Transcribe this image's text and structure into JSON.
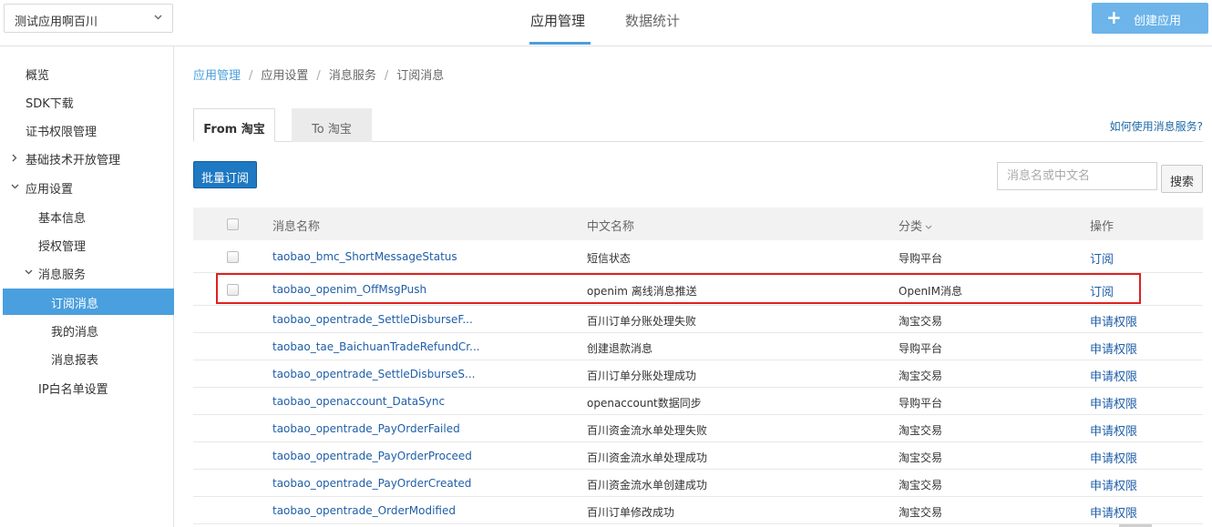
{
  "header": {
    "app_selector": "测试应用啊百川",
    "nav_tabs": [
      "应用管理",
      "数据统计"
    ],
    "create_button": "创建应用",
    "accent_color": "#4a9fde"
  },
  "sidebar": {
    "items": [
      "概览",
      "SDK下载",
      "证书权限管理",
      "基础技术开放管理",
      "应用设置",
      "基本信息",
      "授权管理",
      "消息服务",
      "订阅消息",
      "我的消息",
      "消息报表",
      "IP白名单设置"
    ],
    "active": "订阅消息"
  },
  "breadcrumb": [
    "应用管理",
    "应用设置",
    "消息服务",
    "订阅消息"
  ],
  "tabs": {
    "from": "From 淘宝",
    "to": "To 淘宝"
  },
  "help_link": "如何使用消息服务?",
  "toolbar": {
    "batch_button": "批量订阅",
    "search_placeholder": "消息名或中文名",
    "search_button": "搜索"
  },
  "table": {
    "headers": {
      "name": "消息名称",
      "cn_name": "中文名称",
      "category": "分类",
      "action": "操作"
    },
    "rows": [
      {
        "name": "taobao_bmc_ShortMessageStatus",
        "cn_name": "短信状态",
        "category": "导购平台",
        "action": "订阅",
        "checkbox": true
      },
      {
        "name": "taobao_openim_OffMsgPush",
        "cn_name": "openim 离线消息推送",
        "category": "OpenIM消息",
        "action": "订阅",
        "checkbox": true,
        "highlighted": true
      },
      {
        "name": "taobao_opentrade_SettleDisburseF...",
        "cn_name": "百川订单分账处理失败",
        "category": "淘宝交易",
        "action": "申请权限"
      },
      {
        "name": "taobao_tae_BaichuanTradeRefundCr...",
        "cn_name": "创建退款消息",
        "category": "导购平台",
        "action": "申请权限"
      },
      {
        "name": "taobao_opentrade_SettleDisburseS...",
        "cn_name": "百川订单分账处理成功",
        "category": "淘宝交易",
        "action": "申请权限"
      },
      {
        "name": "taobao_openaccount_DataSync",
        "cn_name": "openaccount数据同步",
        "category": "导购平台",
        "action": "申请权限"
      },
      {
        "name": "taobao_opentrade_PayOrderFailed",
        "cn_name": "百川资金流水单处理失败",
        "category": "淘宝交易",
        "action": "申请权限"
      },
      {
        "name": "taobao_opentrade_PayOrderProceed",
        "cn_name": "百川资金流水单处理成功",
        "category": "淘宝交易",
        "action": "申请权限"
      },
      {
        "name": "taobao_opentrade_PayOrderCreated",
        "cn_name": "百川资金流水单创建成功",
        "category": "淘宝交易",
        "action": "申请权限"
      },
      {
        "name": "taobao_opentrade_OrderModified",
        "cn_name": "百川订单修改成功",
        "category": "淘宝交易",
        "action": "申请权限"
      }
    ]
  }
}
